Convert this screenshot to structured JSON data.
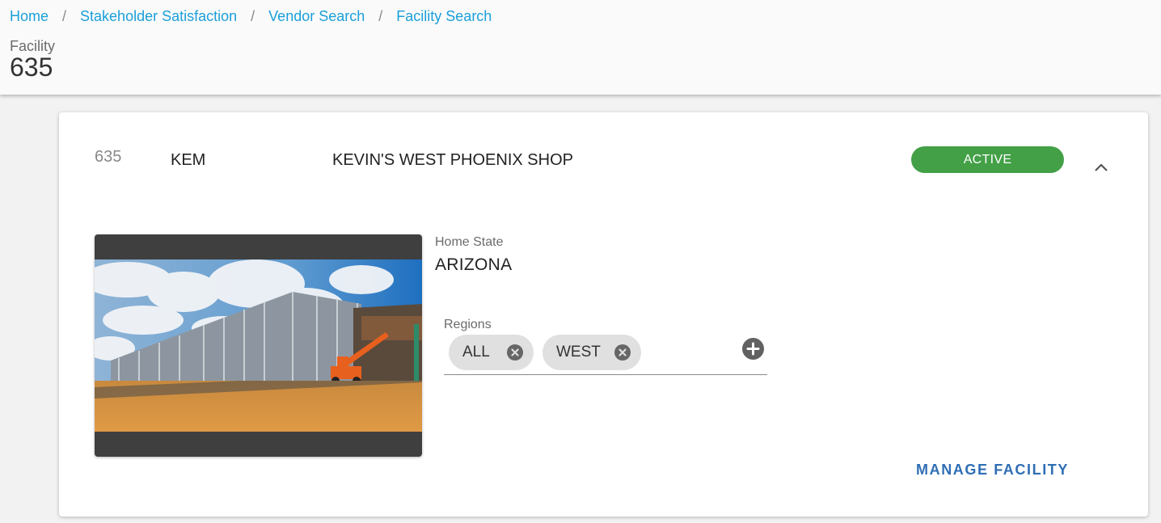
{
  "breadcrumb": [
    {
      "label": "Home"
    },
    {
      "label": "Stakeholder Satisfaction"
    },
    {
      "label": "Vendor Search"
    },
    {
      "label": "Facility Search"
    }
  ],
  "header": {
    "label": "Facility",
    "title": "635"
  },
  "facility": {
    "id": "635",
    "code": "KEM",
    "name": "KEVIN'S WEST PHOENIX SHOP",
    "status": "ACTIVE",
    "status_color": "#43a047",
    "home_state_label": "Home State",
    "home_state": "ARIZONA",
    "regions_label": "Regions",
    "regions": [
      {
        "label": "ALL"
      },
      {
        "label": "WEST"
      }
    ],
    "manage_label": "MANAGE FACILITY",
    "photo_icon": "building-construction-photo"
  },
  "colors": {
    "link": "#1a9fd9",
    "accent": "#2f6eb5"
  }
}
